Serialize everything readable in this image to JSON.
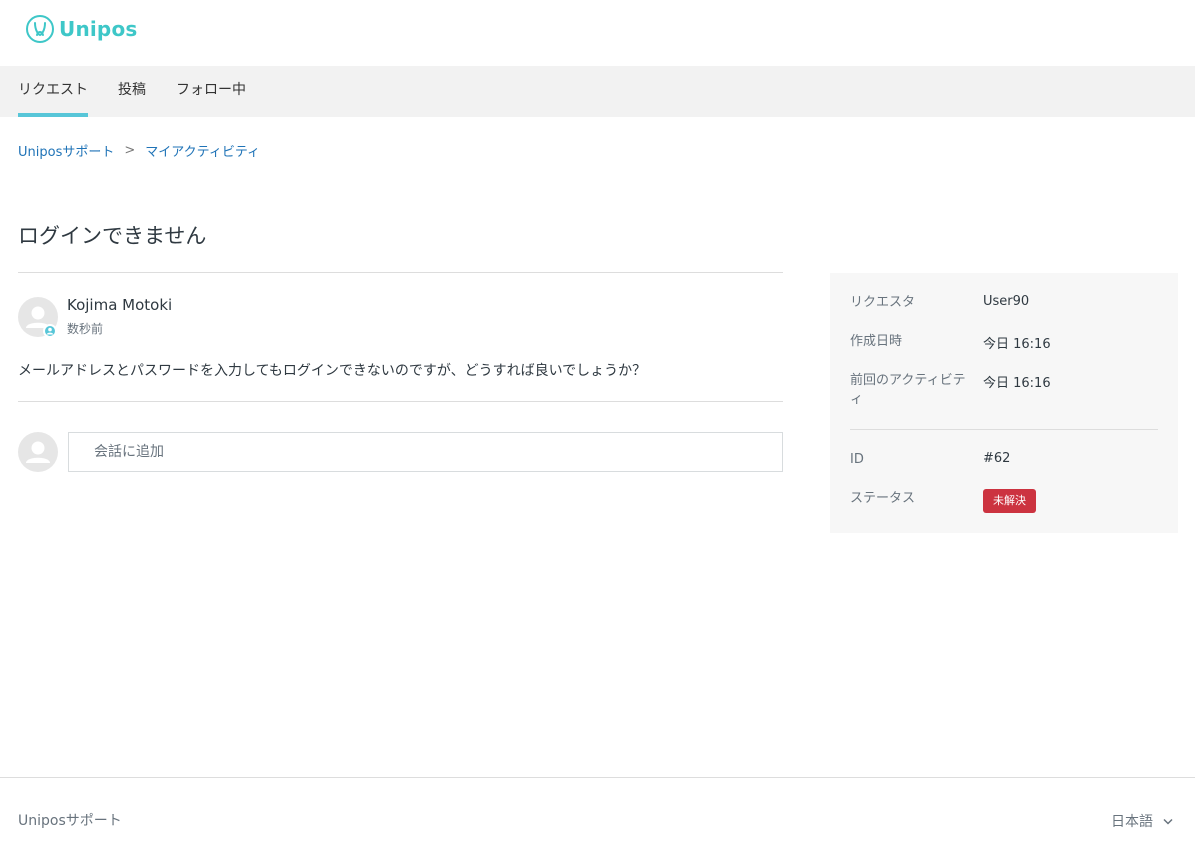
{
  "brand": {
    "name": "Unipos",
    "color": "#3ec7c8"
  },
  "nav": {
    "tabs": [
      {
        "label": "リクエスト",
        "active": true
      },
      {
        "label": "投稿",
        "active": false
      },
      {
        "label": "フォロー中",
        "active": false
      }
    ],
    "active_color": "#57c6d8"
  },
  "breadcrumb": [
    "Uniposサポート",
    "マイアクティビティ"
  ],
  "breadcrumb_separator": ">",
  "request": {
    "title": "ログインできません",
    "author": "Kojima Motoki",
    "time": "数秒前",
    "body": "メールアドレスとパスワードを入力してもログインできないのですが、どうすれば良いでしょうか？",
    "comment_placeholder": "会話に追加"
  },
  "sidebar": {
    "requester": {
      "label": "リクエスタ",
      "value": "User90"
    },
    "created": {
      "label": "作成日時",
      "value": "今日 16:16"
    },
    "last_activity": {
      "label": "前回のアクティビティ",
      "value": "今日 16:16"
    },
    "id": {
      "label": "ID",
      "value": "#62"
    },
    "status": {
      "label": "ステータス",
      "value": "未解決",
      "color": "#cc3340"
    }
  },
  "footer": {
    "brand": "Uniposサポート",
    "language": "日本語"
  }
}
